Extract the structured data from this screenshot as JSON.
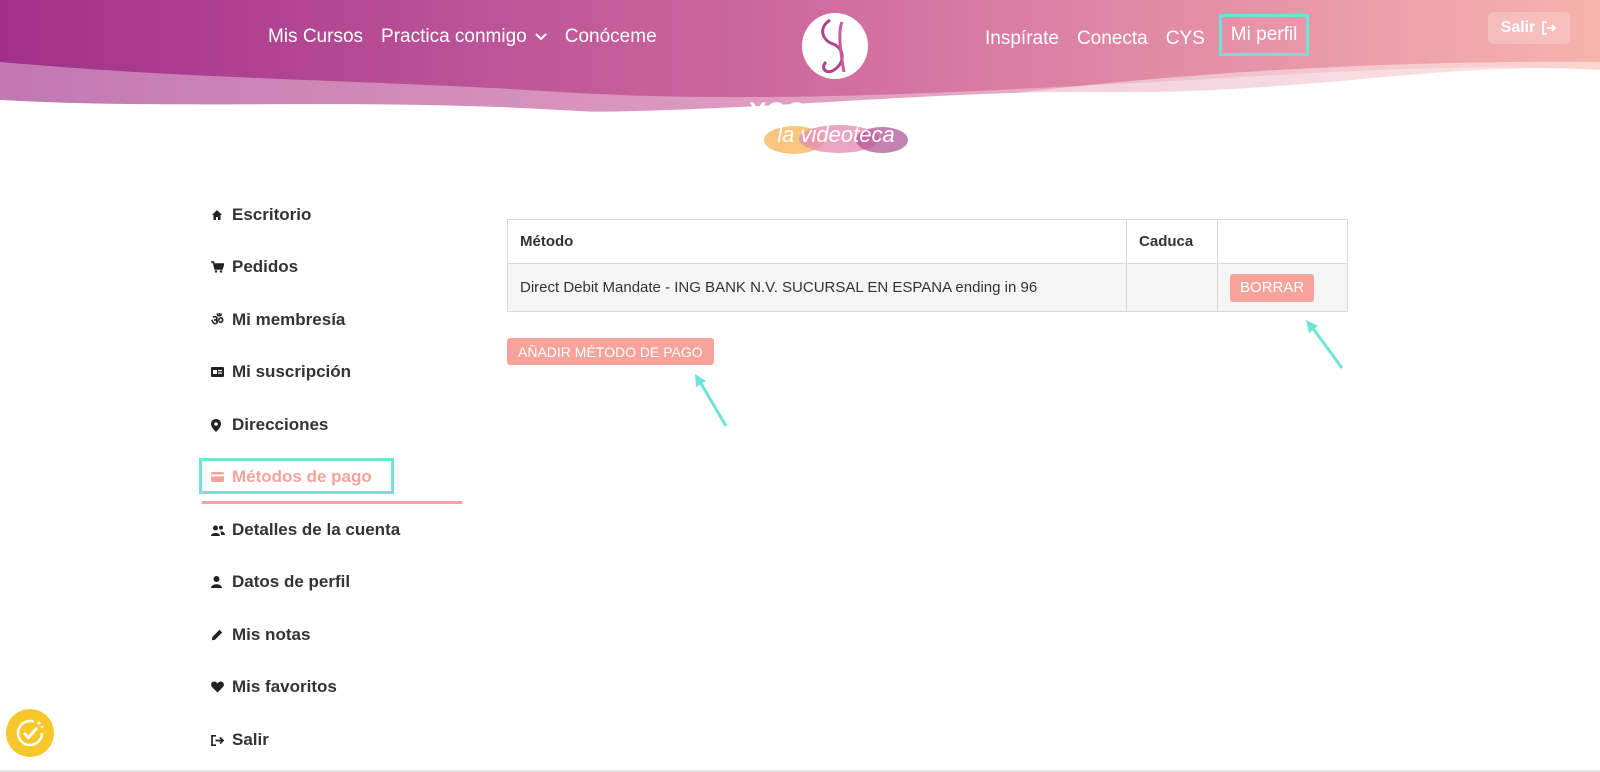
{
  "header": {
    "nav_left": [
      {
        "label": "Mis Cursos"
      },
      {
        "label": "Practica conmigo",
        "has_dropdown": true
      },
      {
        "label": "Conóceme"
      }
    ],
    "nav_right": [
      {
        "label": "Inspírate"
      },
      {
        "label": "Conecta"
      },
      {
        "label": "CYS"
      },
      {
        "label": "Mi perfil",
        "highlighted": true
      }
    ],
    "logout_label": "Salir",
    "logo": {
      "title": "YOGA·SALUD",
      "subtitle": "la videoteca"
    }
  },
  "sidebar": {
    "items": [
      {
        "label": "Escritorio",
        "icon": "home-icon"
      },
      {
        "label": "Pedidos",
        "icon": "cart-icon"
      },
      {
        "label": "Mi membresía",
        "icon": "om-icon"
      },
      {
        "label": "Mi suscripción",
        "icon": "id-card-icon"
      },
      {
        "label": "Direcciones",
        "icon": "map-pin-icon"
      },
      {
        "label": "Métodos de pago",
        "icon": "credit-card-icon",
        "active": true
      },
      {
        "label": "Detalles de la cuenta",
        "icon": "users-icon"
      },
      {
        "label": "Datos de perfil",
        "icon": "user-icon"
      },
      {
        "label": "Mis notas",
        "icon": "pencil-icon"
      },
      {
        "label": "Mis favoritos",
        "icon": "heart-icon"
      },
      {
        "label": "Salir",
        "icon": "sign-out-icon"
      }
    ]
  },
  "payment_methods": {
    "columns": [
      "Método",
      "Caduca",
      ""
    ],
    "rows": [
      {
        "method": "Direct Debit Mandate - ING BANK N.V. SUCURSAL EN ESPANA ending in 96",
        "expires": "",
        "action": "BORRAR"
      }
    ],
    "add_button": "AÑADIR MÉTODO DE PAGO"
  },
  "colors": {
    "accent_salmon": "#f7a39b",
    "highlight_teal": "#6fe3d8",
    "header_gradient_start": "#a0308a",
    "header_gradient_end": "#f7b3ad",
    "badge_yellow": "#f7c72b"
  }
}
